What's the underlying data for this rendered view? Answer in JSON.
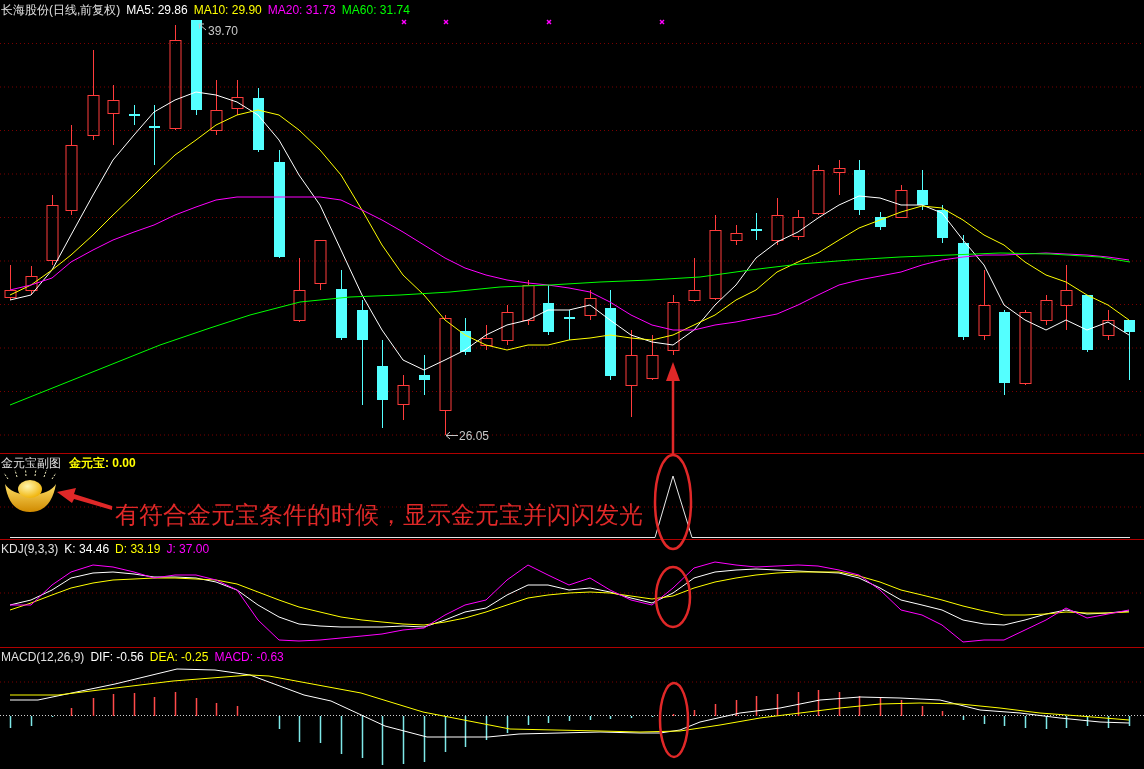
{
  "main_chart": {
    "title": "长海股份(日线,前复权)",
    "indicators": [
      {
        "label": "MA5: 29.86",
        "color": "#ffffff"
      },
      {
        "label": "MA10: 29.90",
        "color": "#ffff00"
      },
      {
        "label": "MA20: 31.73",
        "color": "#ff00ff"
      },
      {
        "label": "MA60: 31.74",
        "color": "#00ff00"
      }
    ],
    "high_label": "39.70",
    "low_label": "26.05"
  },
  "sub_chart": {
    "title": "金元宝副图",
    "indicators": [
      {
        "label": "金元宝: 0.00",
        "color": "#ffff00"
      }
    ]
  },
  "kdj_chart": {
    "title": "KDJ(9,3,3)",
    "indicators": [
      {
        "label": "K: 34.46",
        "color": "#ffffff"
      },
      {
        "label": "D: 33.19",
        "color": "#ffff00"
      },
      {
        "label": "J: 37.00",
        "color": "#ff00ff"
      }
    ]
  },
  "macd_chart": {
    "title": "MACD(12,26,9)",
    "indicators": [
      {
        "label": "DIF: -0.56",
        "color": "#ffffff"
      },
      {
        "label": "DEA: -0.25",
        "color": "#ffff00"
      },
      {
        "label": "MACD: -0.63",
        "color": "#ff00ff"
      }
    ]
  },
  "annotation": {
    "text": "有符合金元宝条件的时候，显示金元宝并闪闪发光"
  }
}
